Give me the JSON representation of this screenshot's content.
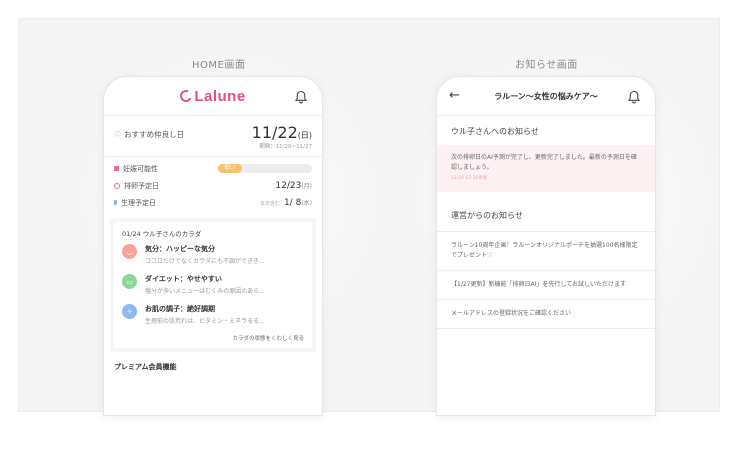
{
  "sections": {
    "home_title": "HOME画面",
    "notice_title": "お知らせ画面"
  },
  "home": {
    "logo": "Lalune",
    "recommended": {
      "label": "おすすめ仲良し日",
      "date": "11/22",
      "dow": "(日)",
      "period": "期間：11/20~11/27"
    },
    "pregnancy": {
      "label": "妊娠可能性",
      "level_text": "低い",
      "level_fraction": 0.25
    },
    "ovulation": {
      "label": "排卵予定日",
      "date": "12/23",
      "dow": "(月)"
    },
    "period_row": {
      "label": "生理予定日",
      "prefix": "本日含む",
      "date": "1/ 8",
      "dow": "(水)"
    },
    "body": {
      "header": "01/24 ウル子さんのカラダ",
      "items": [
        {
          "title": "気分：ハッピーな気分",
          "desc": "ココロだけでなくカラダにも不調ができき...",
          "color": "#f5a49a",
          "icon": "smile"
        },
        {
          "title": "ダイエット：やせやすい",
          "desc": "塩分が多いメニューはむくみの原因のあら...",
          "color": "#8fd69a",
          "icon": "scale"
        },
        {
          "title": "お肌の調子：絶好調期",
          "desc": "生理前の肌荒れは、ビタミン・ミネラるる...",
          "color": "#8fb8f0",
          "icon": "sparkle"
        }
      ],
      "more": "カラダの状態をくわしく見る"
    },
    "premium": "プレミアム会員機能"
  },
  "notice": {
    "title": "ラルーン〜女性の悩みケア〜",
    "personal_header": "ウル子さんへのお知らせ",
    "highlight": {
      "text": "次の排卵日のAI予測が完了し、更新完了しました。最新の予測日を確認しましょう。",
      "time": "11/26 17:30更新"
    },
    "ops_header": "運営からのお知らせ",
    "ops_items": [
      "ラルーン10周年企画！ラルーンオリジナルポーチを抽選100名様限定でプレゼント♡",
      "【1/27更新】新機能「排卵日AI」を先行してお試しいただけます",
      "メールアドレスの登録状況をご確認ください"
    ]
  },
  "colors": {
    "brand": "#e2507a",
    "highlight_bg": "#fdf1f3",
    "pregnancy_bar": "#f6c36a"
  }
}
